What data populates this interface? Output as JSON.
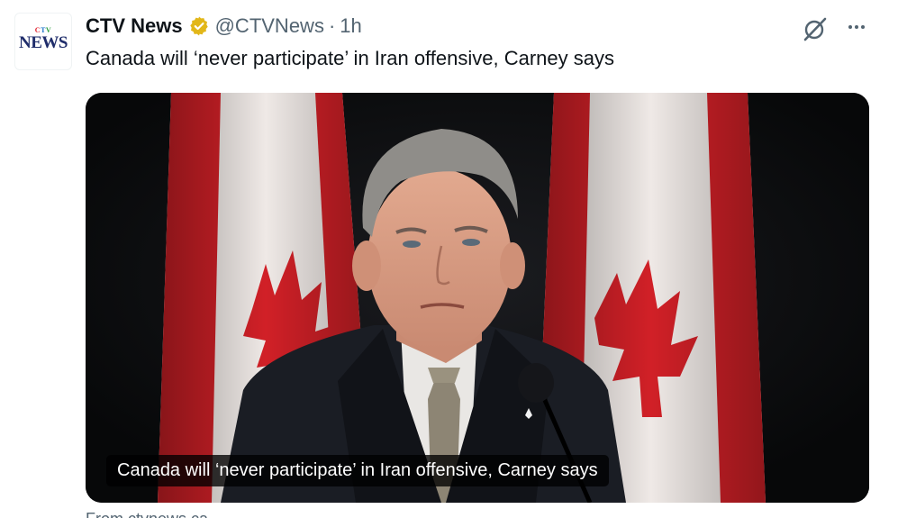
{
  "account": {
    "avatar_logo_top": "CTV",
    "avatar_logo_bottom": "NEWS",
    "display_name": "CTV News",
    "handle": "@CTVNews",
    "separator": "·",
    "time": "1h",
    "verified_badge_icon": "verified-gold-badge-icon"
  },
  "tweet": {
    "text": "Canada will ‘never participate’ in Iran offensive, Carney says"
  },
  "media": {
    "caption": "Canada will ‘never participate’ in Iran offensive, Carney says"
  },
  "footer": {
    "peek_text": "From ctvnews.ca"
  },
  "icons": {
    "grok": "grok-icon",
    "more": "more-options-icon"
  },
  "colors": {
    "secondary_text": "#536471",
    "verified_gold": "#e2b719",
    "flag_red": "#d12027"
  }
}
